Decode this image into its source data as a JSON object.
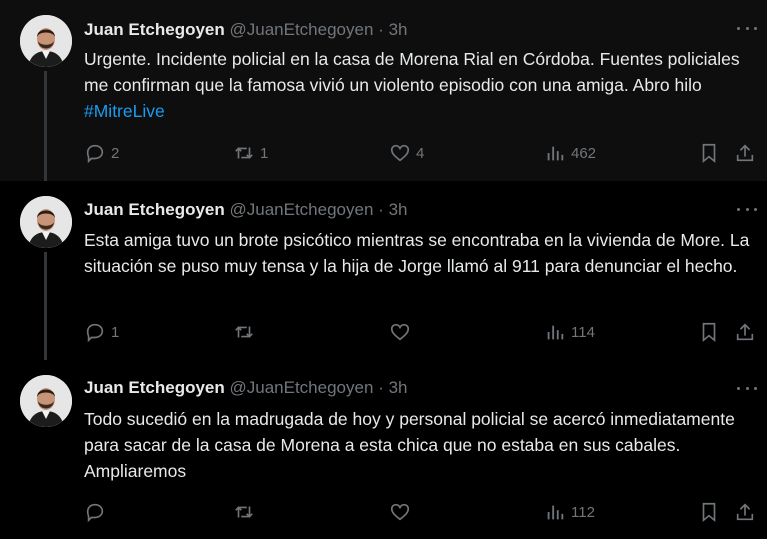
{
  "author": {
    "name": "Juan Etchegoyen",
    "handle": "@JuanEtchegoyen",
    "separator": "·",
    "time": "3h"
  },
  "tweets": [
    {
      "text": "Urgente. Incidente policial en la casa de Morena Rial en Córdoba. Fuentes policiales me confirman que la famosa vivió un violento episodio con una amiga. Abro hilo ",
      "hashtag": "#MitreLive",
      "replies": "2",
      "retweets": "1",
      "likes": "4",
      "views": "462"
    },
    {
      "text": "Esta amiga tuvo un brote psicótico mientras se encontraba en la vivienda de More. La situación se puso muy tensa y la hija de Jorge llamó al 911 para denunciar el hecho.",
      "replies": "1",
      "retweets": "",
      "likes": "",
      "views": "114"
    },
    {
      "text": "Todo sucedió en la madrugada de hoy y personal policial se acercó inmediatamente para sacar de la casa de Morena a esta chica que no estaba en sus cabales. Ampliaremos",
      "replies": "",
      "retweets": "",
      "likes": "",
      "views": "112"
    }
  ],
  "icons": {
    "reply": "reply-icon",
    "retweet": "retweet-icon",
    "like": "heart-icon",
    "views": "views-icon",
    "bookmark": "bookmark-icon",
    "share": "share-icon",
    "more": "more-icon"
  },
  "colors": {
    "background": "#000000",
    "highlight_background": "#0e0e0e",
    "text": "#e7e9ea",
    "secondary": "#71767b",
    "link": "#1d9bf0"
  }
}
